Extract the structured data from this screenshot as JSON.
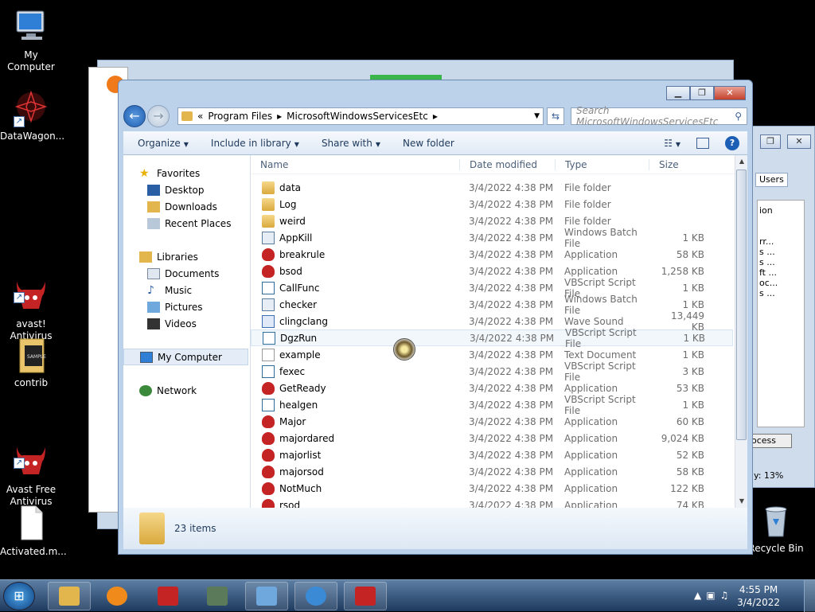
{
  "desktop": {
    "icons": [
      {
        "label": "My Computer"
      },
      {
        "label": "DataWagon..."
      },
      {
        "label": "avast!\nAntivirus"
      },
      {
        "label": "contrib"
      },
      {
        "label": "Avast Free\nAntivirus"
      },
      {
        "label": "Activated.m..."
      },
      {
        "label": "Recycle Bin"
      }
    ]
  },
  "bg_window": {
    "tab_users": "Users",
    "btn_process": "ocess",
    "label_cpu": "y: 13%",
    "col_header": "ion",
    "rows": [
      "rr...",
      "s ...",
      "s ...",
      "ft ...",
      "oc...",
      "s ..."
    ]
  },
  "window": {
    "address": {
      "chevron": "«",
      "crumbs": [
        "Program Files",
        "MicrosoftWindowsServicesEtc"
      ]
    },
    "search_placeholder": "Search MicrosoftWindowsServicesEtc",
    "toolbar": {
      "organize": "Organize",
      "include_in_library": "Include in library",
      "share_with": "Share with",
      "new_folder": "New folder"
    },
    "nav": {
      "favorites": "Favorites",
      "desktop": "Desktop",
      "downloads": "Downloads",
      "recent_places": "Recent Places",
      "libraries": "Libraries",
      "documents": "Documents",
      "music": "Music",
      "pictures": "Pictures",
      "videos": "Videos",
      "my_computer": "My Computer",
      "network": "Network"
    },
    "columns": {
      "name": "Name",
      "date": "Date modified",
      "type": "Type",
      "size": "Size"
    },
    "files": [
      {
        "name": "data",
        "date": "3/4/2022 4:38 PM",
        "type": "File folder",
        "size": "",
        "icon": "folder-icon"
      },
      {
        "name": "Log",
        "date": "3/4/2022 4:38 PM",
        "type": "File folder",
        "size": "",
        "icon": "folder-icon"
      },
      {
        "name": "weird",
        "date": "3/4/2022 4:38 PM",
        "type": "File folder",
        "size": "",
        "icon": "folder-icon"
      },
      {
        "name": "AppKill",
        "date": "3/4/2022 4:38 PM",
        "type": "Windows Batch File",
        "size": "1 KB",
        "icon": "batch-file-icon"
      },
      {
        "name": "breakrule",
        "date": "3/4/2022 4:38 PM",
        "type": "Application",
        "size": "58 KB",
        "icon": "app-icon"
      },
      {
        "name": "bsod",
        "date": "3/4/2022 4:38 PM",
        "type": "Application",
        "size": "1,258 KB",
        "icon": "app-icon"
      },
      {
        "name": "CallFunc",
        "date": "3/4/2022 4:38 PM",
        "type": "VBScript Script File",
        "size": "1 KB",
        "icon": "vbscript-icon"
      },
      {
        "name": "checker",
        "date": "3/4/2022 4:38 PM",
        "type": "Windows Batch File",
        "size": "1 KB",
        "icon": "batch-file-icon"
      },
      {
        "name": "clingclang",
        "date": "3/4/2022 4:38 PM",
        "type": "Wave Sound",
        "size": "13,449 KB",
        "icon": "wave-sound-icon"
      },
      {
        "name": "DgzRun",
        "date": "3/4/2022 4:38 PM",
        "type": "VBScript Script File",
        "size": "1 KB",
        "icon": "vbscript-icon"
      },
      {
        "name": "example",
        "date": "3/4/2022 4:38 PM",
        "type": "Text Document",
        "size": "1 KB",
        "icon": "text-document-icon"
      },
      {
        "name": "fexec",
        "date": "3/4/2022 4:38 PM",
        "type": "VBScript Script File",
        "size": "3 KB",
        "icon": "vbscript-icon"
      },
      {
        "name": "GetReady",
        "date": "3/4/2022 4:38 PM",
        "type": "Application",
        "size": "53 KB",
        "icon": "app-icon"
      },
      {
        "name": "healgen",
        "date": "3/4/2022 4:38 PM",
        "type": "VBScript Script File",
        "size": "1 KB",
        "icon": "vbscript-icon"
      },
      {
        "name": "Major",
        "date": "3/4/2022 4:38 PM",
        "type": "Application",
        "size": "60 KB",
        "icon": "app-icon"
      },
      {
        "name": "majordared",
        "date": "3/4/2022 4:38 PM",
        "type": "Application",
        "size": "9,024 KB",
        "icon": "app-icon"
      },
      {
        "name": "majorlist",
        "date": "3/4/2022 4:38 PM",
        "type": "Application",
        "size": "52 KB",
        "icon": "app-icon"
      },
      {
        "name": "majorsod",
        "date": "3/4/2022 4:38 PM",
        "type": "Application",
        "size": "58 KB",
        "icon": "app-icon"
      },
      {
        "name": "NotMuch",
        "date": "3/4/2022 4:38 PM",
        "type": "Application",
        "size": "122 KB",
        "icon": "app-icon"
      },
      {
        "name": "rsod",
        "date": "3/4/2022 4:38 PM",
        "type": "Application",
        "size": "74 KB",
        "icon": "app-icon"
      }
    ],
    "status": {
      "item_count": "23 items"
    }
  },
  "taskbar": {
    "clock_time": "4:55 PM",
    "clock_date": "3/4/2022"
  }
}
